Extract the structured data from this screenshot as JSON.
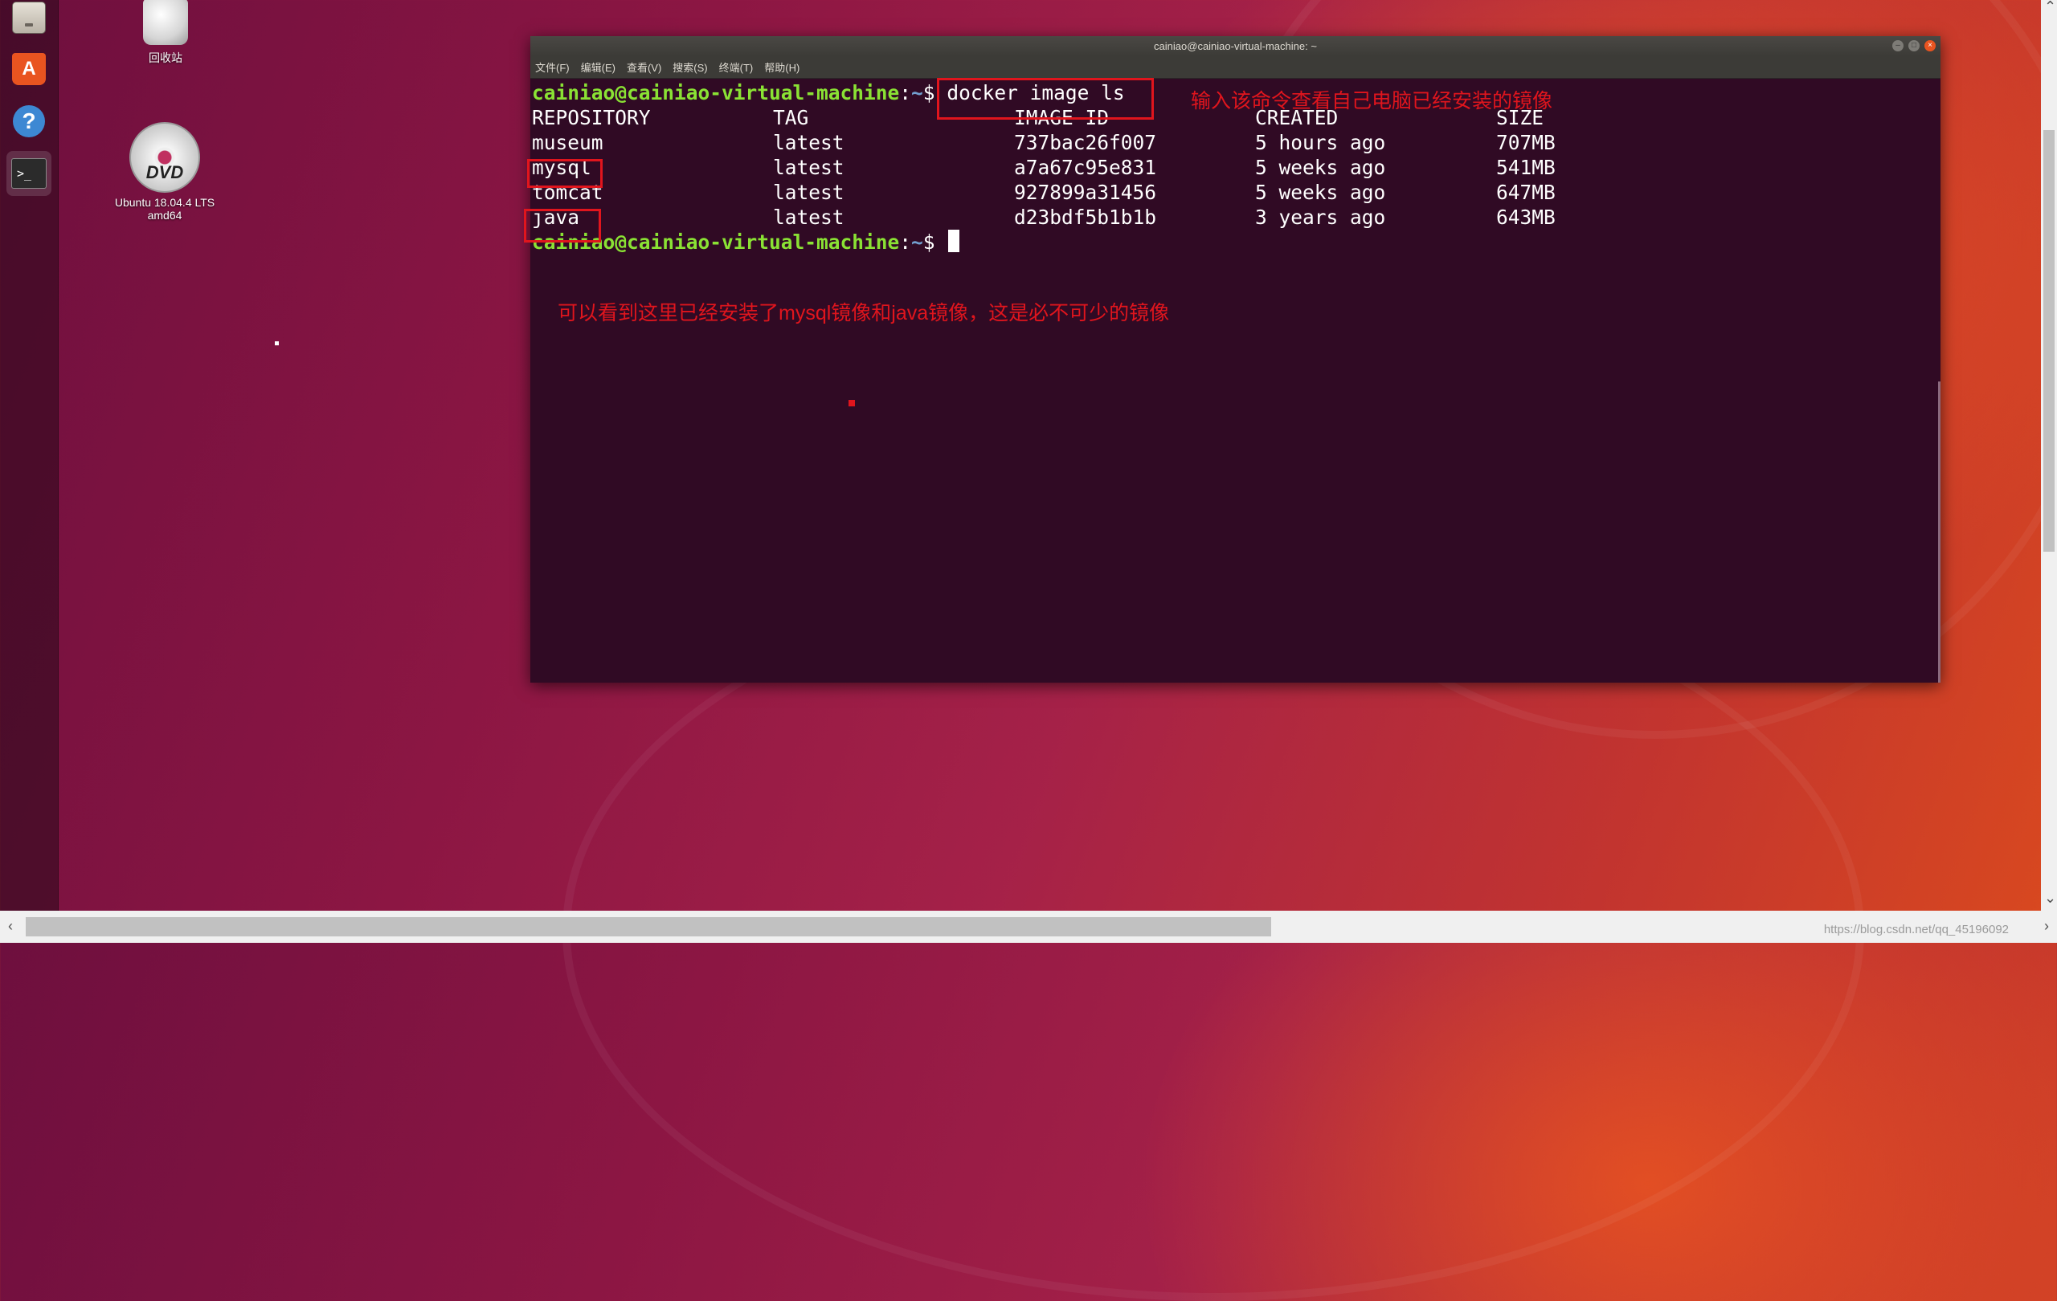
{
  "desktop": {
    "trash_label": "回收站",
    "dvd_badge": "DVD",
    "dvd_label_line1": "Ubuntu 18.04.4 LTS",
    "dvd_label_line2": "amd64"
  },
  "dock": {
    "items": [
      {
        "name": "files",
        "icon": "file-cabinet-icon"
      },
      {
        "name": "software",
        "icon": "shopping-bag-icon",
        "glyph": "A"
      },
      {
        "name": "help",
        "icon": "help-icon",
        "glyph": "?"
      },
      {
        "name": "terminal",
        "icon": "terminal-icon",
        "glyph": ">_",
        "active": true
      }
    ]
  },
  "terminal": {
    "title": "cainiao@cainiao-virtual-machine: ~",
    "menu": [
      "文件(F)",
      "编辑(E)",
      "查看(V)",
      "搜索(S)",
      "终端(T)",
      "帮助(H)"
    ],
    "prompt_user": "cainiao@cainiao-virtual-machine",
    "prompt_sep": ":",
    "prompt_path": "~",
    "prompt_dollar": "$ ",
    "command": "docker image ls",
    "headers": [
      "REPOSITORY",
      "TAG",
      "IMAGE ID",
      "CREATED",
      "SIZE"
    ],
    "rows": [
      [
        "museum",
        "latest",
        "737bac26f007",
        "5 hours ago",
        "707MB"
      ],
      [
        "mysql",
        "latest",
        "a7a67c95e831",
        "5 weeks ago",
        "541MB"
      ],
      [
        "tomcat",
        "latest",
        "927899a31456",
        "5 weeks ago",
        "647MB"
      ],
      [
        "java",
        "latest",
        "d23bdf5b1b1b",
        "3 years ago",
        "643MB"
      ]
    ]
  },
  "annotations": {
    "command_note": "输入该命令查看自己电脑已经安装的镜像",
    "summary_note": "可以看到这里已经安装了mysql镜像和java镜像，这是必不可少的镜像"
  },
  "watermark": "https://blog.csdn.net/qq_45196092",
  "colors": {
    "terminal_bg": "#300a24",
    "prompt_user": "#8ae234",
    "prompt_path": "#729fcf",
    "annotation_red": "#e0151d",
    "ubuntu_orange": "#e95420"
  }
}
